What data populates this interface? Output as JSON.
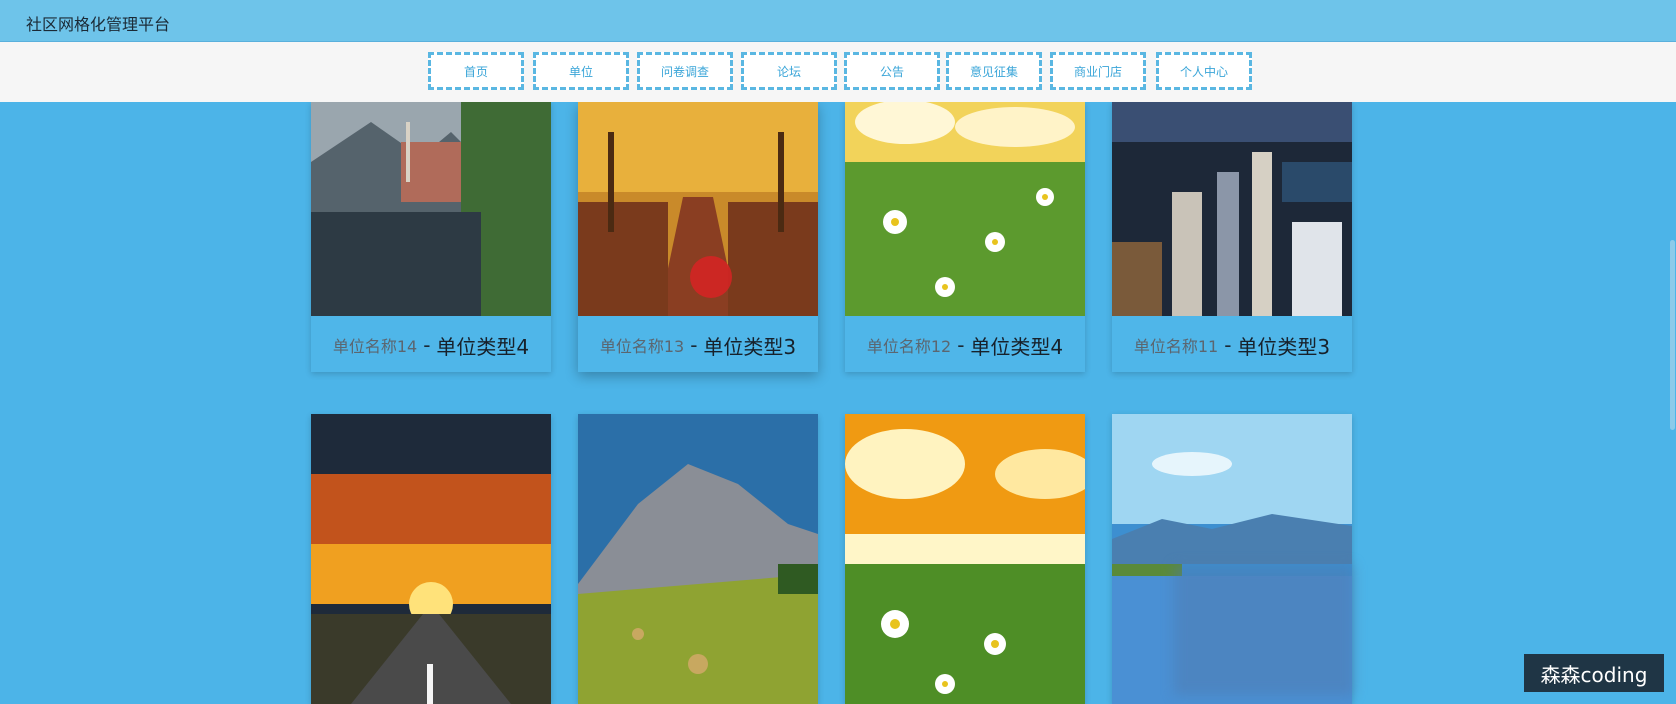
{
  "header": {
    "title": "社区网格化管理平台"
  },
  "nav": {
    "items": [
      {
        "label": "首页"
      },
      {
        "label": "单位"
      },
      {
        "label": "问卷调查"
      },
      {
        "label": "论坛"
      },
      {
        "label": "公告"
      },
      {
        "label": "意见征集"
      },
      {
        "label": "商业门店"
      },
      {
        "label": "个人中心"
      }
    ]
  },
  "cards": {
    "row1": [
      {
        "name": "单位名称14",
        "sep": "-",
        "type": "单位类型4",
        "image": "lake-village-photo"
      },
      {
        "name": "单位名称13",
        "sep": "-",
        "type": "单位类型3",
        "image": "autumn-avenue-photo"
      },
      {
        "name": "单位名称12",
        "sep": "-",
        "type": "单位类型4",
        "image": "daisy-field-photo"
      },
      {
        "name": "单位名称11",
        "sep": "-",
        "type": "单位类型3",
        "image": "city-night-photo"
      }
    ],
    "row2": [
      {
        "image": "sunset-road-photo"
      },
      {
        "image": "mountain-meadow-photo"
      },
      {
        "image": "daisy-sunrise-photo"
      },
      {
        "image": "blue-lake-photo"
      }
    ]
  },
  "watermark": {
    "text": "森森coding"
  }
}
